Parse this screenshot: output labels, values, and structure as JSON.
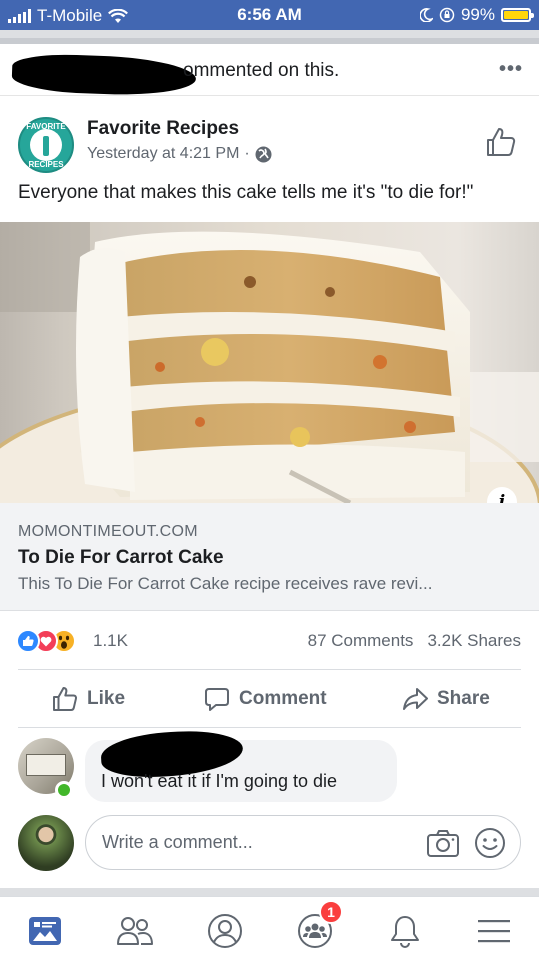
{
  "status_bar": {
    "carrier": "T-Mobile",
    "time": "6:56 AM",
    "battery": "99%",
    "battery_level": 0.99
  },
  "activity": {
    "text": "ommented on this.",
    "more_icon": "more-dots-icon"
  },
  "post": {
    "page_name": "Favorite Recipes",
    "avatar_text_top": "FAVORITE",
    "avatar_text_bottom": "RECIPES",
    "timestamp": "Yesterday at 4:21 PM",
    "separator": "·",
    "privacy_icon": "globe-icon",
    "like_page_icon": "thumbs-up-icon",
    "text": "Everyone that makes this cake tells me it's \"to die for!\"",
    "info_badge": "i"
  },
  "link_preview": {
    "domain": "MOMONTIMEOUT.COM",
    "title": "To Die For Carrot Cake",
    "description": "This To Die For Carrot Cake recipe receives rave revi..."
  },
  "reactions": {
    "count": "1.1K",
    "types": [
      "like",
      "love",
      "wow"
    ],
    "comments": "87 Comments",
    "shares": "3.2K Shares"
  },
  "actions": {
    "like": "Like",
    "comment": "Comment",
    "share": "Share"
  },
  "comment": {
    "text": "I won't eat it if I'm going to die"
  },
  "composer": {
    "placeholder": "Write a comment..."
  },
  "tabbar": {
    "items": [
      "news-feed-icon",
      "friends-icon",
      "profile-icon",
      "groups-icon",
      "notifications-icon",
      "menu-icon"
    ],
    "groups_badge": "1"
  },
  "colors": {
    "brand": "#4267b2",
    "text_primary": "#1c1e21",
    "text_secondary": "#606770",
    "like_blue": "#2d88ff",
    "love_red": "#f33e58",
    "wow_yellow": "#f7b125",
    "badge_red": "#fa3e3e",
    "online_green": "#42b72a"
  }
}
